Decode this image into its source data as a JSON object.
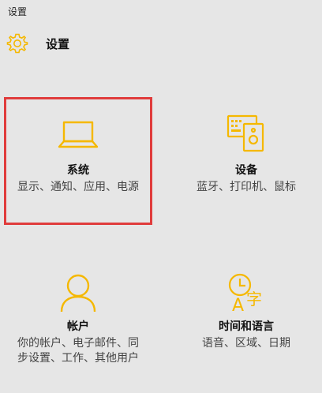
{
  "window": {
    "title": "设置"
  },
  "header": {
    "title": "设置",
    "icon": "gear-icon"
  },
  "accent": "#f5b800",
  "tiles": [
    {
      "name": "系统",
      "desc": "显示、通知、应用、电源",
      "icon": "laptop-icon",
      "selected": true
    },
    {
      "name": "设备",
      "desc": "蓝牙、打印机、鼠标",
      "icon": "devices-icon",
      "selected": false
    },
    {
      "name": "帐户",
      "desc": "你的帐户、电子邮件、同步设置、工作、其他用户",
      "icon": "person-icon",
      "selected": false
    },
    {
      "name": "时间和语言",
      "desc": "语音、区域、日期",
      "icon": "time-language-icon",
      "selected": false
    }
  ]
}
